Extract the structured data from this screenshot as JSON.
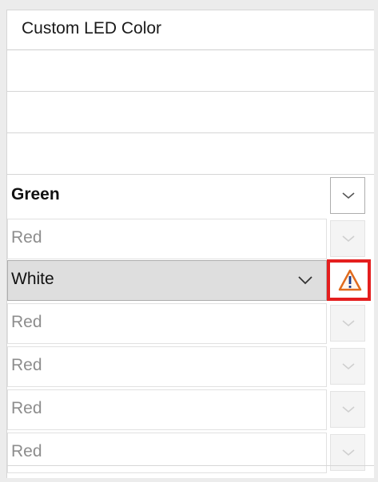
{
  "header": {
    "title": "Custom LED Color"
  },
  "rows": [
    {
      "value": "Green",
      "state": "active"
    },
    {
      "value": "Red",
      "state": "disabled"
    },
    {
      "value": "White",
      "state": "selected-warning"
    },
    {
      "value": "Red",
      "state": "disabled"
    },
    {
      "value": "Red",
      "state": "disabled"
    },
    {
      "value": "Red",
      "state": "disabled"
    },
    {
      "value": "Red",
      "state": "disabled"
    }
  ],
  "icons": {
    "dropdown": "chevron-down-icon",
    "warning": "warning-triangle-icon"
  },
  "colors": {
    "highlight_border": "#e41e1e",
    "warning_icon": "#e06a1d",
    "selected_bg": "#dedede"
  }
}
